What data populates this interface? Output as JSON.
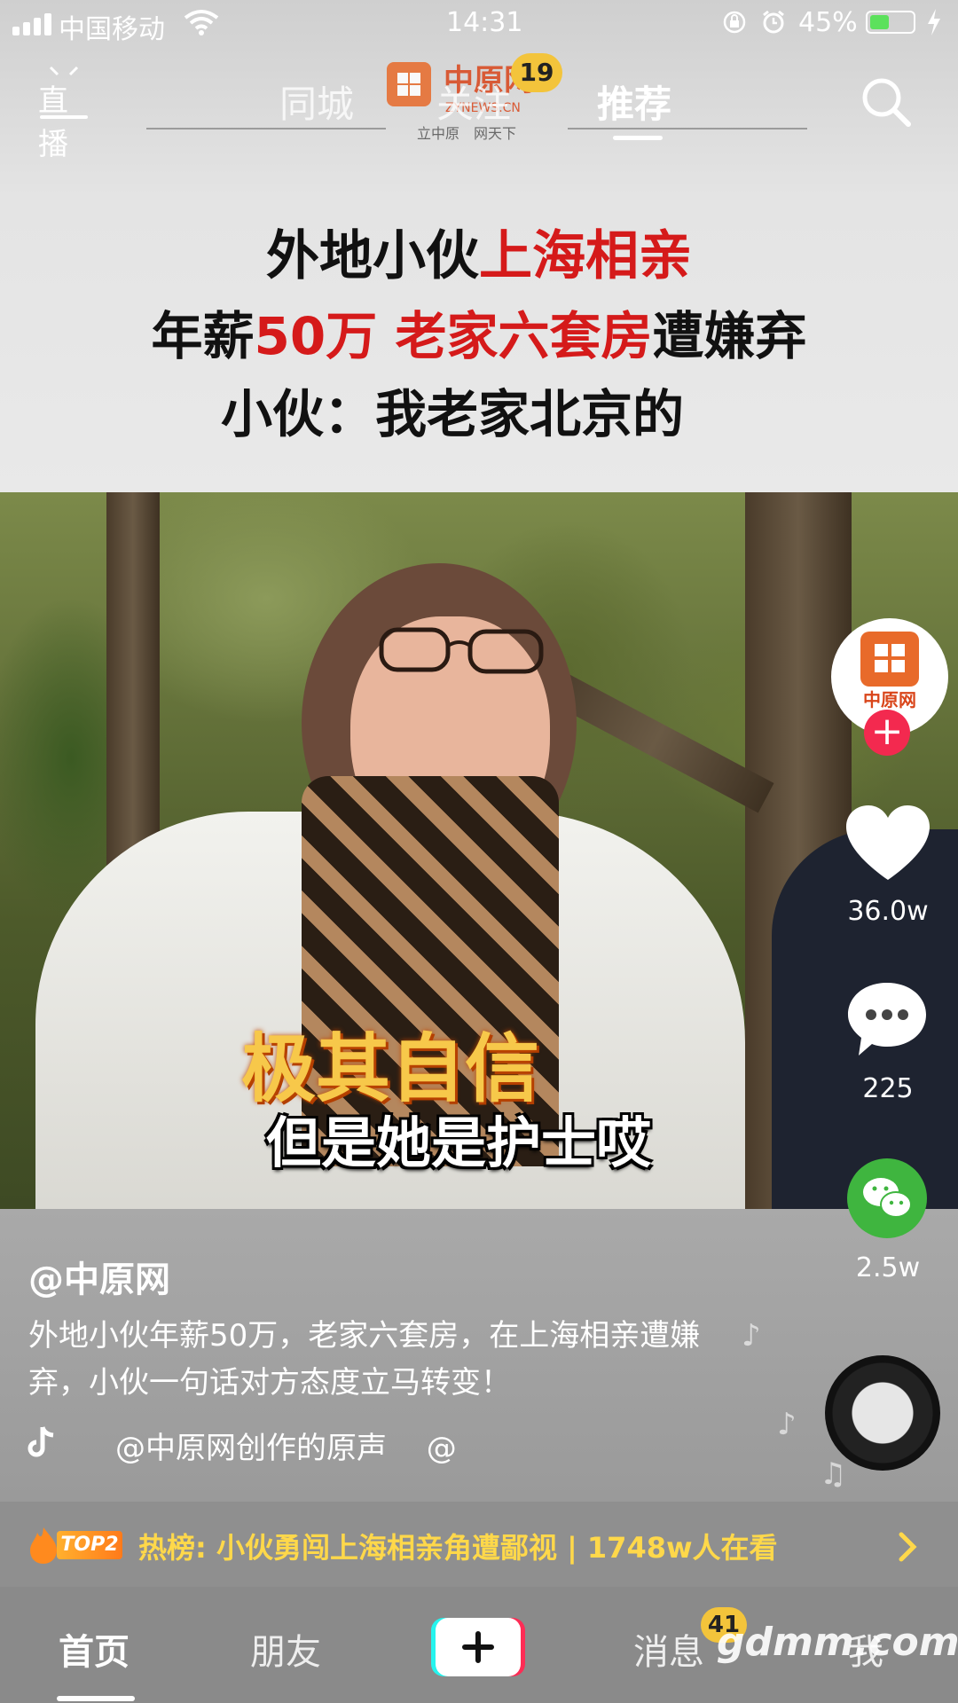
{
  "status_bar": {
    "carrier": "中国移动",
    "time": "14:31",
    "battery_percent": "45%",
    "battery_level": 0.45
  },
  "top_nav": {
    "live_label": "直播",
    "tabs": [
      {
        "label": "同城"
      },
      {
        "label": "关注",
        "badge": "19"
      },
      {
        "label": "推荐"
      }
    ],
    "watermark_logo_text": "中原网",
    "watermark_logo_sub": "ZYNEWS.CN",
    "watermark_slogan": "立中原　网天下"
  },
  "headline": {
    "line1": [
      {
        "text": "外地小伙",
        "color": "#111111"
      },
      {
        "text": "上海相亲",
        "color": "#d51a1a"
      }
    ],
    "line2": [
      {
        "text": "年薪",
        "color": "#111111"
      },
      {
        "text": "50万 老家六套房",
        "color": "#d51a1a"
      },
      {
        "text": "遭嫌弃",
        "color": "#111111"
      }
    ],
    "line3": [
      {
        "text": "小伙：我老家北京的",
        "color": "#111111"
      }
    ]
  },
  "video": {
    "subtitle_highlight": "极其自信",
    "subtitle_main": "但是她是护士哎"
  },
  "right_rail": {
    "avatar_text": "中原网",
    "likes": "36.0w",
    "comments": "225",
    "shares": "2.5w"
  },
  "post": {
    "author": "@中原网",
    "caption": "外地小伙年薪50万，老家六套房，在上海相亲遭嫌弃，小伙一句话对方态度立马转变！",
    "music": "@中原网创作的原声　 @"
  },
  "hot_bar": {
    "rank_tag": "TOP2",
    "text": "热榜: 小伙勇闯上海相亲角遭鄙视 | 1748w人在看"
  },
  "tab_bar": {
    "home": "首页",
    "friends": "朋友",
    "messages": "消息",
    "messages_badge": "41",
    "me": "我",
    "watermark": "gdmm.com"
  },
  "colors": {
    "accent_red": "#d51a1a",
    "badge_yellow": "#f3c43b",
    "follow_pink": "#f3294f",
    "wechat_green": "#3fb53f",
    "hot_text": "#ffd84a"
  },
  "icons": [
    "signal-icon",
    "wifi-icon",
    "lock-rotation-icon",
    "alarm-icon",
    "battery-icon",
    "charging-icon",
    "search-icon",
    "heart-icon",
    "comment-icon",
    "wechat-icon",
    "music-disc-icon",
    "tiktok-icon",
    "flame-icon",
    "chevron-right-icon",
    "plus-icon"
  ]
}
